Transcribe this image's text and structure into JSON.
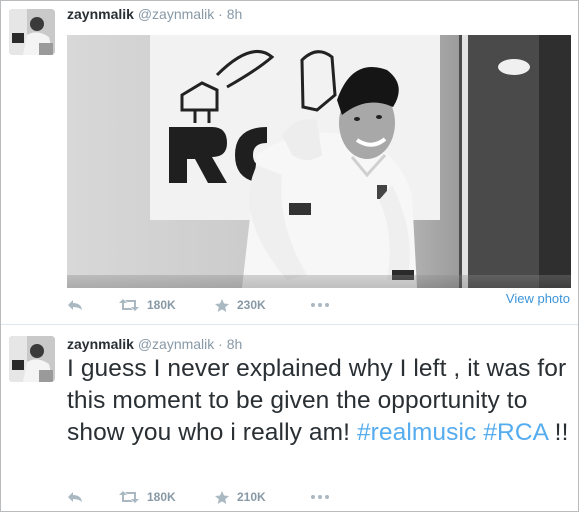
{
  "tweets": [
    {
      "name": "zaynmalik",
      "handle": "@zaynmalik",
      "separator": "·",
      "time": "8h",
      "photo_alt": "RCA",
      "view_photo": "View photo",
      "retweets": "180K",
      "favorites": "230K"
    },
    {
      "name": "zaynmalik",
      "handle": "@zaynmalik",
      "separator": "·",
      "time": "8h",
      "text": "I guess I never explained why I left , it was for this moment to be given the opportunity to show you who i really am!",
      "hashtag1": "#realmusic",
      "hashtag2": "#RCA",
      "text_end": "!!",
      "retweets": "180K",
      "favorites": "210K"
    }
  ],
  "icons": [
    "reply-icon",
    "retweet-icon",
    "favorite-icon",
    "more-icon"
  ],
  "colors": {
    "link": "#3b94d9",
    "hashtag": "#55acee",
    "muted": "#8899a6",
    "text": "#292f33"
  }
}
